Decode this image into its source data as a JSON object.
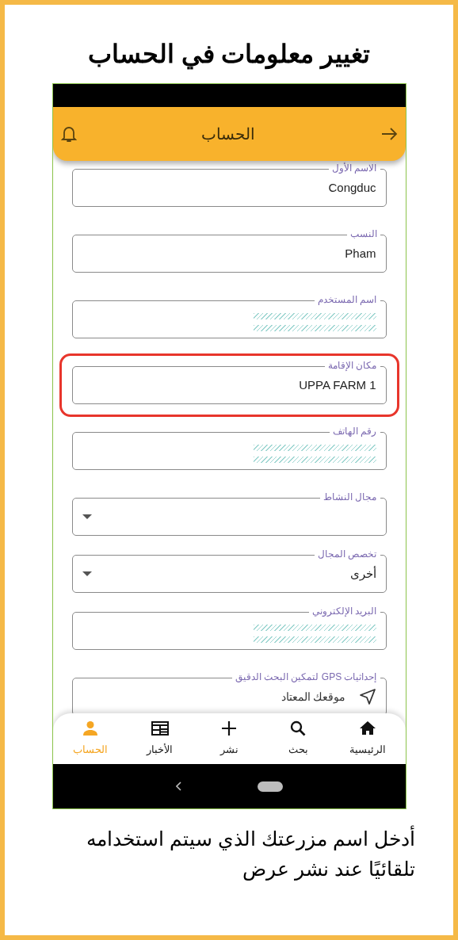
{
  "heading": "تغيير معلومات في الحساب",
  "app_bar": {
    "title": "الحساب"
  },
  "fields": [
    {
      "kind": "text",
      "label": "الاسم الأول",
      "value": "Congduc",
      "highlighted": false
    },
    {
      "kind": "text",
      "label": "النسب",
      "value": "Pham",
      "highlighted": false
    },
    {
      "kind": "redacted",
      "label": "اسم المستخدم",
      "highlighted": false
    },
    {
      "kind": "text",
      "label": "مكان الإقامة",
      "value": "UPPA FARM 1",
      "highlighted": true
    },
    {
      "kind": "redacted",
      "label": "رقم الهاتف",
      "highlighted": false
    },
    {
      "kind": "dropdown",
      "label": "مجال النشاط",
      "highlighted": false
    },
    {
      "kind": "dropdown",
      "label": "تخصص المجال",
      "value": "أخرى",
      "highlighted": false
    },
    {
      "kind": "redacted",
      "label": "البريد الإلكتروني",
      "highlighted": false
    },
    {
      "kind": "gps",
      "label": "إحداثيات GPS لتمكين البحث الدقيق",
      "value": "موقعك المعتاد",
      "highlighted": false
    }
  ],
  "bottom_nav": [
    {
      "kind": "home",
      "label": "الرئيسية",
      "selected": false
    },
    {
      "kind": "search",
      "label": "بحث",
      "selected": false
    },
    {
      "kind": "plus",
      "label": "نشر",
      "selected": false
    },
    {
      "kind": "news",
      "label": "الأخبار",
      "selected": false
    },
    {
      "kind": "person",
      "label": "الحساب",
      "selected": true
    }
  ],
  "caption": "أدخل اسم مزرعتك الذي سيتم استخدامه تلقائيًا عند نشر عرض"
}
